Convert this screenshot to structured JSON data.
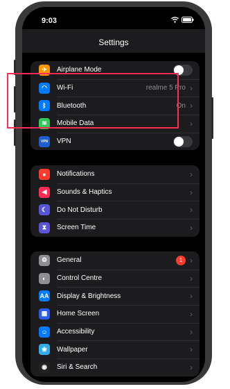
{
  "status": {
    "time": "9:03"
  },
  "header": {
    "title": "Settings"
  },
  "groups": [
    {
      "rows": [
        {
          "label": "Airplane Mode",
          "icon": "airplane-icon",
          "color": "#ff9500",
          "accessory": "toggle",
          "on": false
        },
        {
          "label": "Wi-Fi",
          "icon": "wifi-icon",
          "color": "#007aff",
          "value": "realme 5 Pro",
          "accessory": "chevron"
        },
        {
          "label": "Bluetooth",
          "icon": "bluetooth-icon",
          "color": "#007aff",
          "value": "On",
          "accessory": "chevron"
        },
        {
          "label": "Mobile Data",
          "icon": "antenna-icon",
          "color": "#34c759",
          "accessory": "chevron"
        },
        {
          "label": "VPN",
          "icon": "vpn-icon",
          "color": "#1e5ecf",
          "icon_text": "VPN",
          "accessory": "toggle",
          "on": false
        }
      ]
    },
    {
      "rows": [
        {
          "label": "Notifications",
          "icon": "bell-icon",
          "color": "#ff3b30",
          "accessory": "chevron"
        },
        {
          "label": "Sounds & Haptics",
          "icon": "speaker-icon",
          "color": "#ff2d55",
          "accessory": "chevron"
        },
        {
          "label": "Do Not Disturb",
          "icon": "moon-icon",
          "color": "#5856d6",
          "accessory": "chevron"
        },
        {
          "label": "Screen Time",
          "icon": "hourglass-icon",
          "color": "#5856d6",
          "accessory": "chevron"
        }
      ]
    },
    {
      "rows": [
        {
          "label": "General",
          "icon": "gear-icon",
          "color": "#8e8e93",
          "badge": "1",
          "accessory": "chevron"
        },
        {
          "label": "Control Centre",
          "icon": "switches-icon",
          "color": "#8e8e93",
          "accessory": "chevron"
        },
        {
          "label": "Display & Brightness",
          "icon": "display-icon",
          "color": "#007aff",
          "icon_text": "AA",
          "accessory": "chevron"
        },
        {
          "label": "Home Screen",
          "icon": "grid-icon",
          "color": "#2c5ee8",
          "accessory": "chevron"
        },
        {
          "label": "Accessibility",
          "icon": "accessibility-icon",
          "color": "#007aff",
          "accessory": "chevron"
        },
        {
          "label": "Wallpaper",
          "icon": "wallpaper-icon",
          "color": "#32ade6",
          "accessory": "chevron"
        },
        {
          "label": "Siri & Search",
          "icon": "siri-icon",
          "color": "#222222",
          "accessory": "chevron"
        }
      ]
    }
  ],
  "highlight_color": "#ff2d55"
}
